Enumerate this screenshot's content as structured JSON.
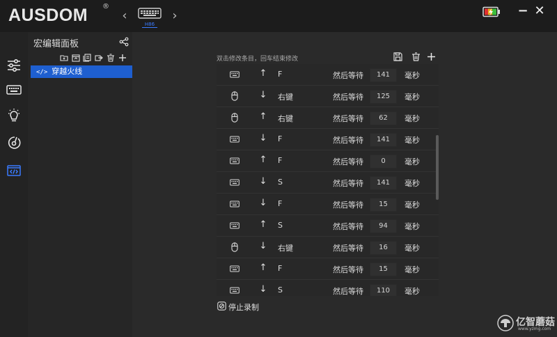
{
  "app": {
    "logo": "AUSDOM",
    "logo_mark": "®",
    "device_name": "H86",
    "prev_label": "‹",
    "next_label": "›",
    "minimize_label": "−",
    "close_label": "✕"
  },
  "panel": {
    "title": "宏编辑面板",
    "macro_name": "穿越火线",
    "macro_code": "</>"
  },
  "editor": {
    "hint": "双击修改条目，回车结束修改",
    "stop_label": "停止录制",
    "rows": [
      {
        "device": "keyboard",
        "direction": "up",
        "key": "F",
        "then": "然后等待",
        "ms": "141",
        "unit": "毫秒"
      },
      {
        "device": "mouse",
        "direction": "down",
        "key": "右键",
        "then": "然后等待",
        "ms": "125",
        "unit": "毫秒"
      },
      {
        "device": "mouse",
        "direction": "up",
        "key": "右键",
        "then": "然后等待",
        "ms": "62",
        "unit": "毫秒"
      },
      {
        "device": "keyboard",
        "direction": "down",
        "key": "F",
        "then": "然后等待",
        "ms": "141",
        "unit": "毫秒"
      },
      {
        "device": "keyboard",
        "direction": "up",
        "key": "F",
        "then": "然后等待",
        "ms": "0",
        "unit": "毫秒"
      },
      {
        "device": "keyboard",
        "direction": "down",
        "key": "S",
        "then": "然后等待",
        "ms": "141",
        "unit": "毫秒"
      },
      {
        "device": "keyboard",
        "direction": "down",
        "key": "F",
        "then": "然后等待",
        "ms": "15",
        "unit": "毫秒"
      },
      {
        "device": "keyboard",
        "direction": "up",
        "key": "S",
        "then": "然后等待",
        "ms": "94",
        "unit": "毫秒"
      },
      {
        "device": "mouse",
        "direction": "down",
        "key": "右键",
        "then": "然后等待",
        "ms": "16",
        "unit": "毫秒"
      },
      {
        "device": "keyboard",
        "direction": "up",
        "key": "F",
        "then": "然后等待",
        "ms": "15",
        "unit": "毫秒"
      },
      {
        "device": "keyboard",
        "direction": "down",
        "key": "S",
        "then": "然后等待",
        "ms": "110",
        "unit": "毫秒"
      }
    ]
  },
  "watermark": {
    "text": "亿智蘑菇",
    "sub": "www.yzmg.com"
  },
  "colors": {
    "accent": "#1e5fd0",
    "device_accent": "#3a7bff"
  },
  "icons": {
    "keyboard": "keyboard-icon",
    "mouse": "mouse-icon",
    "up": "arrow-up-icon",
    "down": "arrow-down-icon"
  }
}
